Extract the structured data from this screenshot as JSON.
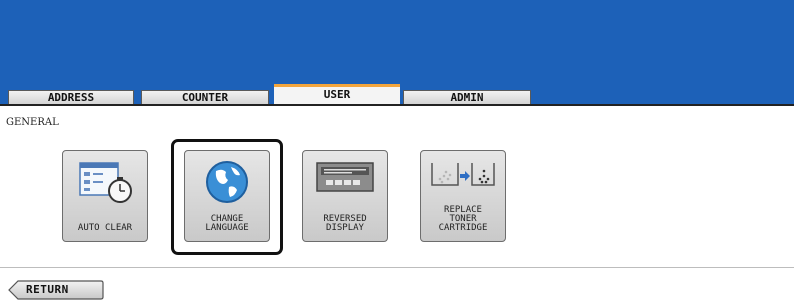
{
  "tabs": [
    {
      "label": "ADDRESS",
      "active": false
    },
    {
      "label": "COUNTER",
      "active": false
    },
    {
      "label": "USER",
      "active": true
    },
    {
      "label": "ADMIN",
      "active": false
    }
  ],
  "section_label": "GENERAL",
  "tiles": [
    {
      "label": "AUTO CLEAR",
      "icon": "auto-clear-timer-icon"
    },
    {
      "label": "CHANGE\nLANGUAGE",
      "icon": "globe-icon",
      "selected": true
    },
    {
      "label": "REVERSED\nDISPLAY",
      "icon": "display-panel-icon"
    },
    {
      "label": "REPLACE\nTONER\nCARTRIDGE",
      "icon": "toner-replace-icon"
    }
  ],
  "return_label": "RETURN",
  "colors": {
    "header_blue": "#1d61b8",
    "active_tab_accent": "#f3a53c"
  }
}
